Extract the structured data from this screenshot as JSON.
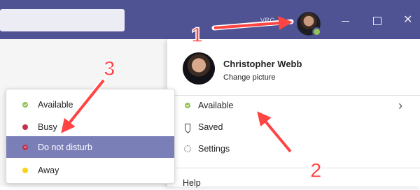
{
  "titlebar": {
    "text": "VRC",
    "window_controls": {
      "minimize": "minimize-icon",
      "maximize": "maximize-icon",
      "close": "✕"
    }
  },
  "profile": {
    "name": "Christopher Webb",
    "change_picture": "Change picture",
    "rows": {
      "available": "Available",
      "saved": "Saved",
      "settings": "Settings",
      "help": "Help"
    }
  },
  "status_menu": {
    "items": [
      {
        "label": "Available",
        "color": "#92c353"
      },
      {
        "label": "Busy",
        "color": "#c4314b"
      },
      {
        "label": "Do not disturb",
        "color": "#c4314b"
      },
      {
        "label": "Away",
        "color": "#fcd116"
      }
    ],
    "selected": "Do not disturb"
  },
  "annotations": {
    "step1": "1",
    "step2": "2",
    "step3": "3",
    "color": "#ff4444"
  },
  "colors": {
    "titlebar": "#4f5393",
    "selected": "#7b7fb8"
  }
}
